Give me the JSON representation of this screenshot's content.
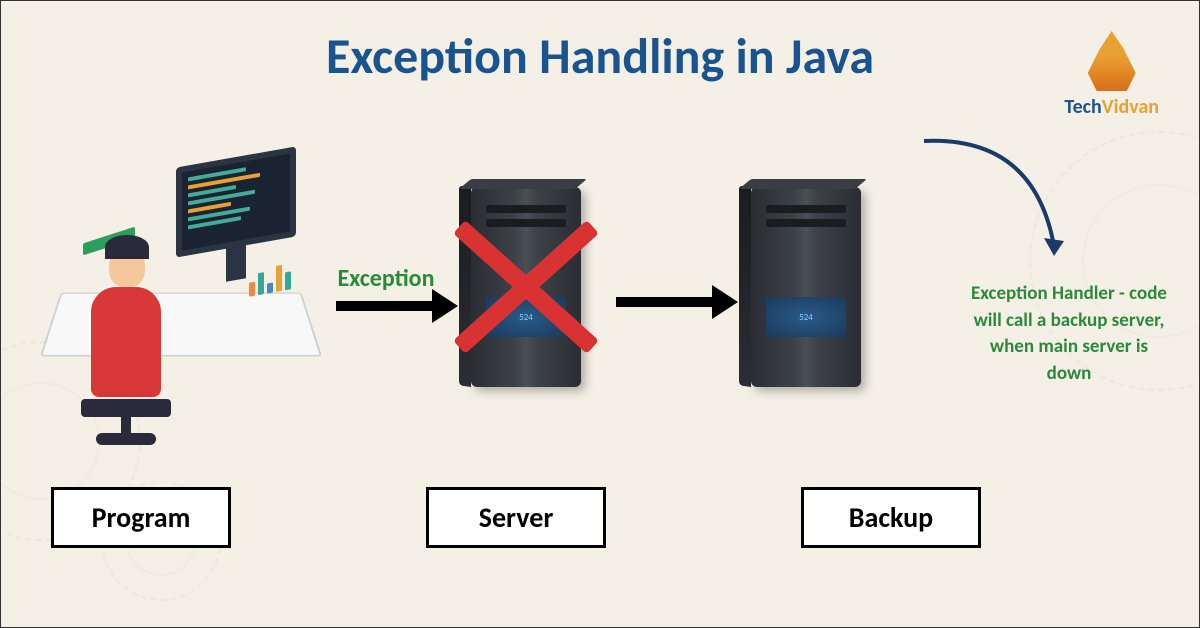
{
  "title": "Exception Handling in Java",
  "logo": {
    "first": "Tech",
    "second": "Vidvan"
  },
  "arrows": {
    "exception": "Exception"
  },
  "labels": {
    "program": "Program",
    "server": "Server",
    "backup": "Backup"
  },
  "handler_text": "Exception Handler - code will call a backup server, when main server is down",
  "server_panel": "524"
}
